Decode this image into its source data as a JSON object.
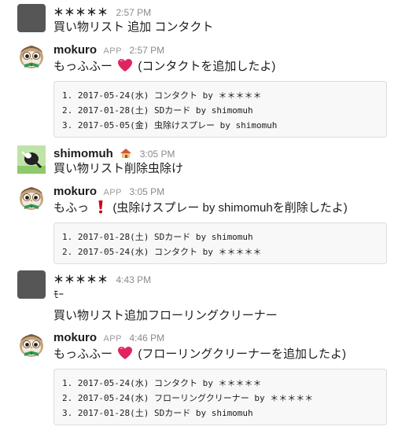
{
  "messages": [
    {
      "name": "＊＊＊＊＊",
      "time": "2:57 PM",
      "text": "買い物リスト 追加 コンタクト"
    },
    {
      "name": "mokuro",
      "app_badge": "APP",
      "time": "2:57 PM",
      "text_before": "もっふふー",
      "text_after": "(コンタクトを追加したよ)",
      "list": [
        "1. 2017-05-24(水) コンタクト by ＊＊＊＊＊",
        "2. 2017-01-28(土) SDカード by shimomuh",
        "3. 2017-05-05(金) 虫除けスプレー by shimomuh"
      ]
    },
    {
      "name": "shimomuh",
      "time": "3:05 PM",
      "text": "買い物リスト削除虫除け"
    },
    {
      "name": "mokuro",
      "app_badge": "APP",
      "time": "3:05 PM",
      "text_before": "もふっ",
      "text_after": "(虫除けスプレー by shimomuhを削除したよ)",
      "list": [
        "1. 2017-01-28(土) SDカード by shimomuh",
        "2. 2017-05-24(水) コンタクト by ＊＊＊＊＊"
      ]
    },
    {
      "name": "＊＊＊＊＊",
      "time": "4:43 PM",
      "text_line1": "ﾓｰ",
      "text_line2": "買い物リスト追加フローリングクリーナー"
    },
    {
      "name": "mokuro",
      "app_badge": "APP",
      "time": "4:46 PM",
      "text_before": "もっふふー",
      "text_after": "(フローリングクリーナーを追加したよ)",
      "list": [
        "1. 2017-05-24(水) コンタクト by ＊＊＊＊＊",
        "2. 2017-05-24(水) フローリングクリーナー by ＊＊＊＊＊",
        "3. 2017-01-28(土) SDカード by shimomuh"
      ]
    }
  ],
  "colors": {
    "heart": "#e0245e",
    "exclamation": "#d0021b",
    "owl_body": "#c8a27c",
    "owl_bowtie": "#2e9a5b"
  },
  "icons": [
    "owl-avatar-icon",
    "heart-icon",
    "exclamation-icon",
    "house-emoji-icon"
  ]
}
